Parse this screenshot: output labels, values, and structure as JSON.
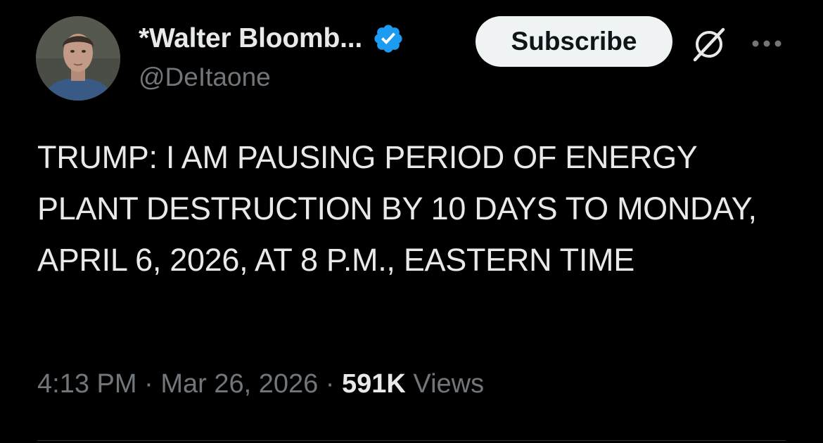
{
  "author": {
    "display_name": "*Walter Bloomb...",
    "handle": "@DeItaone",
    "verified": true
  },
  "actions": {
    "subscribe_label": "Subscribe",
    "grok_icon": "grok-icon",
    "more_icon": "more-icon"
  },
  "tweet": {
    "text": "TRUMP: I AM PAUSING PERIOD OF ENERGY PLANT DESTRUCTION BY 10 DAYS TO MONDAY, APRIL 6, 2026, AT 8 P.M., EASTERN TIME"
  },
  "meta": {
    "time": "4:13 PM",
    "separator": " · ",
    "date": "Mar 26, 2026",
    "views_count": "591K",
    "views_label": " Views"
  },
  "colors": {
    "background": "#000000",
    "text_primary": "#e7e9ea",
    "text_secondary": "#71767b",
    "verified_badge": "#1d9bf0",
    "subscribe_bg": "#eff3f4"
  }
}
